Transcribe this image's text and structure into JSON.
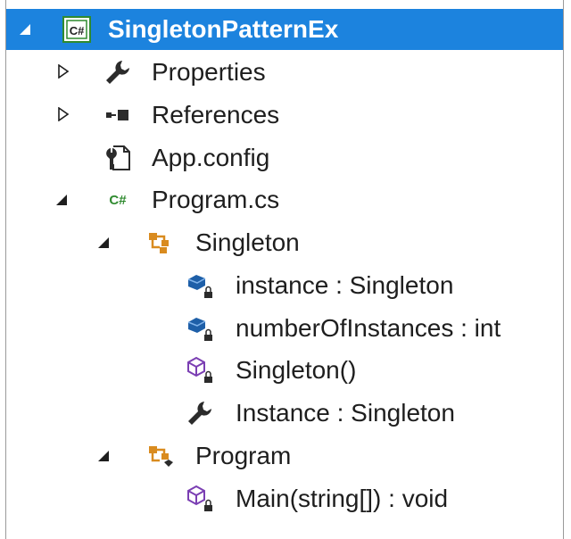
{
  "solution_explorer": {
    "project": {
      "label": "SingletonPatternEx",
      "icon": "csharp-project-icon",
      "expanded": true,
      "selected": true
    },
    "items": [
      {
        "label": "Properties",
        "icon": "wrench-icon",
        "expander": "collapsed"
      },
      {
        "label": "References",
        "icon": "references-icon",
        "expander": "collapsed"
      },
      {
        "label": "App.config",
        "icon": "config-file-icon",
        "expander": "none"
      },
      {
        "label": "Program.cs",
        "icon": "csharp-file-icon",
        "expander": "expanded"
      },
      {
        "label": "Singleton",
        "icon": "class-icon",
        "expander": "expanded"
      },
      {
        "label": "instance : Singleton",
        "icon": "private-field-icon",
        "expander": "none"
      },
      {
        "label": "numberOfInstances : int",
        "icon": "private-field-icon",
        "expander": "none"
      },
      {
        "label": "Singleton()",
        "icon": "private-method-icon",
        "expander": "none"
      },
      {
        "label": "Instance : Singleton",
        "icon": "property-wrench-icon",
        "expander": "none"
      },
      {
        "label": "Program",
        "icon": "internal-class-icon",
        "expander": "expanded"
      },
      {
        "label": "Main(string[]) : void",
        "icon": "private-method-icon",
        "expander": "none"
      }
    ],
    "colors": {
      "selection": "#1c83de",
      "class_icon": "#d98b1f",
      "field_icon": "#1e5fa8",
      "method_icon": "#7b3fb3",
      "csharp_green": "#2f8a2f"
    }
  }
}
